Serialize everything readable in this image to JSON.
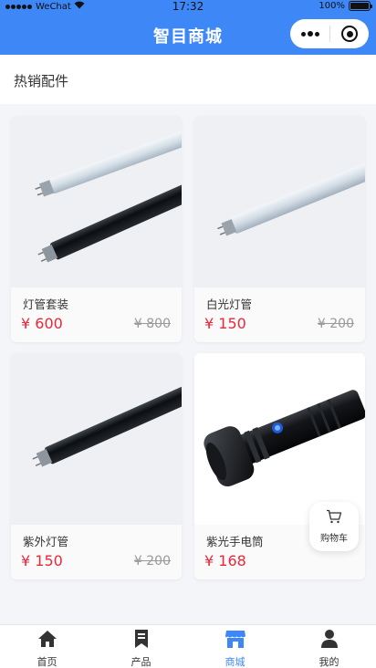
{
  "status_bar": {
    "carrier": "WeChat",
    "time": "17:32",
    "battery": "100%"
  },
  "header": {
    "title": "智目商城",
    "more_icon": "more-dots-icon",
    "close_icon": "target-close-icon"
  },
  "section": {
    "title": "热销配件"
  },
  "products": [
    {
      "name": "灯管套装",
      "price": "¥ 600",
      "old_price": "¥ 800",
      "image": "tube-set-image"
    },
    {
      "name": "白光灯管",
      "price": "¥ 150",
      "old_price": "¥ 200",
      "image": "white-tube-image"
    },
    {
      "name": "紫外灯管",
      "price": "¥ 150",
      "old_price": "¥ 200",
      "image": "uv-tube-image"
    },
    {
      "name": "紫光手电筒",
      "price": "¥ 168",
      "old_price": "",
      "image": "flashlight-image"
    }
  ],
  "cart_button": {
    "label": "购物车",
    "icon": "cart-icon"
  },
  "tabs": [
    {
      "label": "首页",
      "icon": "home-icon",
      "active": false
    },
    {
      "label": "产品",
      "icon": "bookmark-icon",
      "active": false
    },
    {
      "label": "商城",
      "icon": "store-icon",
      "active": true
    },
    {
      "label": "我的",
      "icon": "user-icon",
      "active": false
    }
  ],
  "colors": {
    "brand": "#3d88f6",
    "price": "#e8283b",
    "muted": "#999999"
  }
}
